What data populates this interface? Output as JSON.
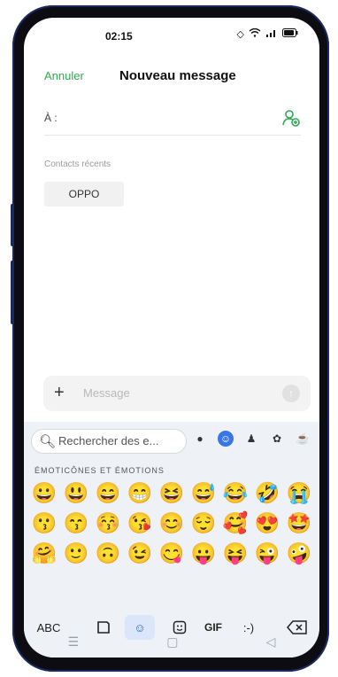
{
  "status": {
    "time": "02:15"
  },
  "header": {
    "cancel_label": "Annuler",
    "title": "Nouveau message"
  },
  "recipient": {
    "label": "À :"
  },
  "recent": {
    "label": "Contacts récents",
    "contacts": [
      "OPPO"
    ]
  },
  "compose": {
    "placeholder": "Message"
  },
  "keyboard": {
    "search_placeholder": "Rechercher des e...",
    "section_title": "ÉMOTICÔNES ET ÉMOTIONS",
    "emojis": [
      "😀",
      "😃",
      "😄",
      "😁",
      "😆",
      "😅",
      "😂",
      "🤣",
      "😭",
      "😗",
      "😙",
      "😚",
      "😘",
      "😊",
      "😌",
      "🥰",
      "😍",
      "🤩",
      "🤗",
      "🙂",
      "🙃",
      "😉",
      "😋",
      "😛",
      "😝",
      "😜",
      "🤪"
    ],
    "bottom": {
      "abc": "ABC",
      "gif": "GIF",
      "text_emoticon": ":-)"
    }
  }
}
